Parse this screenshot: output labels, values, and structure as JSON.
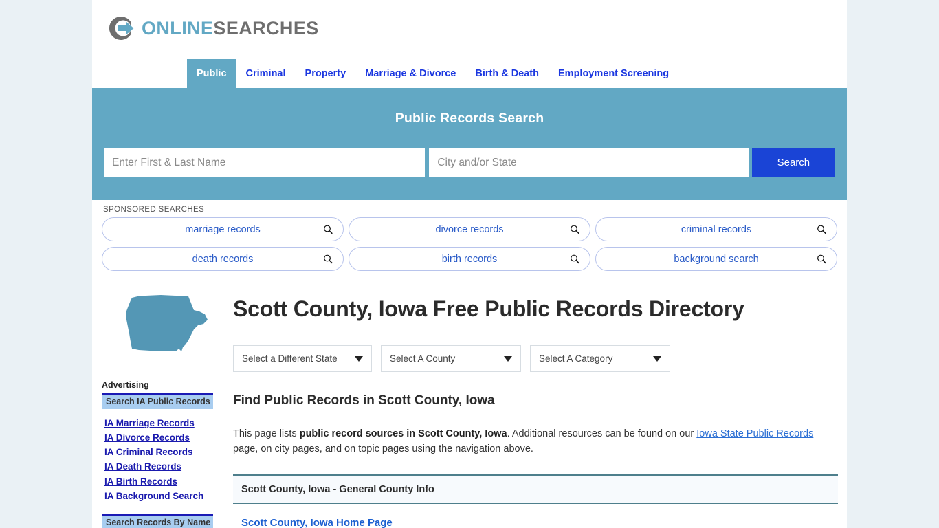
{
  "site": {
    "logo_primary": "ONLINE",
    "logo_secondary": "SEARCHES",
    "logo_icon": "circular-arrow-icon",
    "accent_teal": "#62a8c4",
    "accent_blue": "#1a44d6",
    "link_blue": "#1b37e0",
    "page_bg": "#eaf1f5"
  },
  "nav": {
    "items": [
      {
        "label": "Public",
        "active": true
      },
      {
        "label": "Criminal",
        "active": false
      },
      {
        "label": "Property",
        "active": false
      },
      {
        "label": "Marriage & Divorce",
        "active": false
      },
      {
        "label": "Birth & Death",
        "active": false
      },
      {
        "label": "Employment Screening",
        "active": false
      }
    ]
  },
  "search": {
    "heading": "Public Records Search",
    "name_placeholder": "Enter First & Last Name",
    "name_value": "",
    "place_placeholder": "City and/or State",
    "place_value": "",
    "button_label": "Search"
  },
  "sponsored": {
    "label": "SPONSORED SEARCHES",
    "items": [
      {
        "label": "marriage records",
        "icon": "magnifier-icon"
      },
      {
        "label": "divorce records",
        "icon": "magnifier-icon"
      },
      {
        "label": "criminal records",
        "icon": "magnifier-icon"
      },
      {
        "label": "death records",
        "icon": "magnifier-icon"
      },
      {
        "label": "birth records",
        "icon": "magnifier-icon"
      },
      {
        "label": "background search",
        "icon": "magnifier-icon"
      }
    ]
  },
  "page": {
    "state_icon": "iowa-state-outline-icon",
    "title": "Scott County, Iowa Free Public Records Directory",
    "selects": [
      {
        "value": "Select a Different State"
      },
      {
        "value": "Select A County"
      },
      {
        "value": "Select A Category"
      }
    ]
  },
  "sidebar": {
    "advertising_label": "Advertising",
    "head_1": "Search IA Public Records",
    "links": [
      {
        "label": "IA Marriage Records"
      },
      {
        "label": "IA Divorce Records"
      },
      {
        "label": "IA Criminal Records"
      },
      {
        "label": "IA Death Records"
      },
      {
        "label": "IA Birth Records"
      },
      {
        "label": "IA Background Search"
      }
    ],
    "head_2": "Search Records By Name"
  },
  "main": {
    "heading": "Find Public Records in Scott County, Iowa",
    "paragraph": {
      "lead": "This page lists ",
      "bold": "public record sources in Scott County, Iowa",
      "mid": ". Additional resources can be found on our ",
      "link": "Iowa State Public Records",
      "tail": " page, on city pages, and on topic pages using the navigation above."
    },
    "section_header": "Scott County, Iowa - General County Info",
    "first_result": "Scott County, Iowa Home Page"
  }
}
